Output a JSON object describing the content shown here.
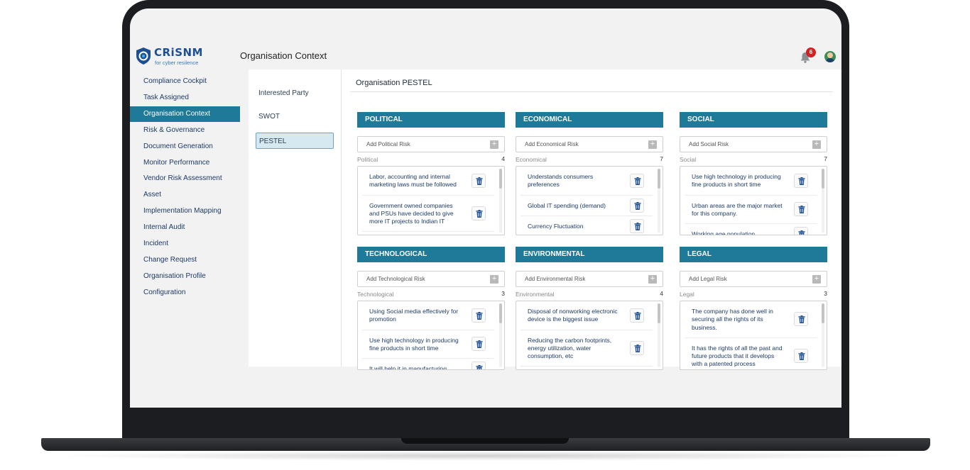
{
  "app": {
    "brand_name": "CRiSNM",
    "brand_tagline": "for cyber resilence",
    "page_title": "Organisation Context",
    "notification_count": "6"
  },
  "sidebar": {
    "items": [
      {
        "label": "Compliance Cockpit",
        "active": false
      },
      {
        "label": "Task Assigned",
        "active": false
      },
      {
        "label": "Organisation Context",
        "active": true
      },
      {
        "label": "Risk & Governance",
        "active": false
      },
      {
        "label": "Document Generation",
        "active": false
      },
      {
        "label": "Monitor Performance",
        "active": false
      },
      {
        "label": "Vendor Risk Assessment",
        "active": false
      },
      {
        "label": "Asset",
        "active": false
      },
      {
        "label": "Implementation Mapping",
        "active": false
      },
      {
        "label": "Internal Audit",
        "active": false
      },
      {
        "label": "Incident",
        "active": false
      },
      {
        "label": "Change Request",
        "active": false
      },
      {
        "label": "Organisation Profile",
        "active": false
      },
      {
        "label": "Configuration",
        "active": false
      }
    ]
  },
  "subnav": {
    "items": [
      {
        "label": "Interested Party",
        "active": false
      },
      {
        "label": "SWOT",
        "active": false
      },
      {
        "label": "PESTEL",
        "active": true
      }
    ]
  },
  "main": {
    "title": "Organisation PESTEL",
    "cards": [
      {
        "heading": "POLITICAL",
        "placeholder": "Add Political Risk",
        "label": "Political",
        "count": "4",
        "risks": [
          "Labor, accounting and internal marketing laws must be followed",
          "Government owned companies and PSUs have decided to give more IT projects to Indian IT"
        ]
      },
      {
        "heading": "ECONOMICAL",
        "placeholder": "Add Economical Risk",
        "label": "Economical",
        "count": "7",
        "risks": [
          "Understands consumers preferences",
          "Global IT spending (demand)",
          "Currency Fluctuation"
        ]
      },
      {
        "heading": "SOCIAL",
        "placeholder": "Add Social Risk",
        "label": "Social",
        "count": "7",
        "risks": [
          "Use high technology in producing fine products in short time",
          "Urban areas are the major market for this company.",
          "Working age population"
        ]
      },
      {
        "heading": "TECHNOLOGICAL",
        "placeholder": "Add Technological Risk",
        "label": "Technological",
        "count": "3",
        "risks": [
          "Using Social media effectively for promotion",
          "Use high technology in producing fine products in short time",
          "It will help it in manufacturing"
        ]
      },
      {
        "heading": "ENVIRONMENTAL",
        "placeholder": "Add Environmental Risk",
        "label": "Environmental",
        "count": "4",
        "risks": [
          "Disposal of nonworking electronic device is the biggest issue",
          "Reducing the carbon footprints, energy utilization, water consumption, etc"
        ]
      },
      {
        "heading": "LEGAL",
        "placeholder": "Add Legal Risk",
        "label": "Legal",
        "count": "3",
        "risks": [
          "The company has done well in securing all the rights of its business.",
          "It has the rights of all the past and future products that it develops with a patented process"
        ]
      }
    ]
  },
  "colors": {
    "accent": "#1f7a9a",
    "brand": "#1d4f91",
    "badge": "#d32020"
  },
  "icons": [
    "shield-logo-icon",
    "bell-icon",
    "avatar-icon",
    "plus-icon",
    "trash-icon"
  ]
}
